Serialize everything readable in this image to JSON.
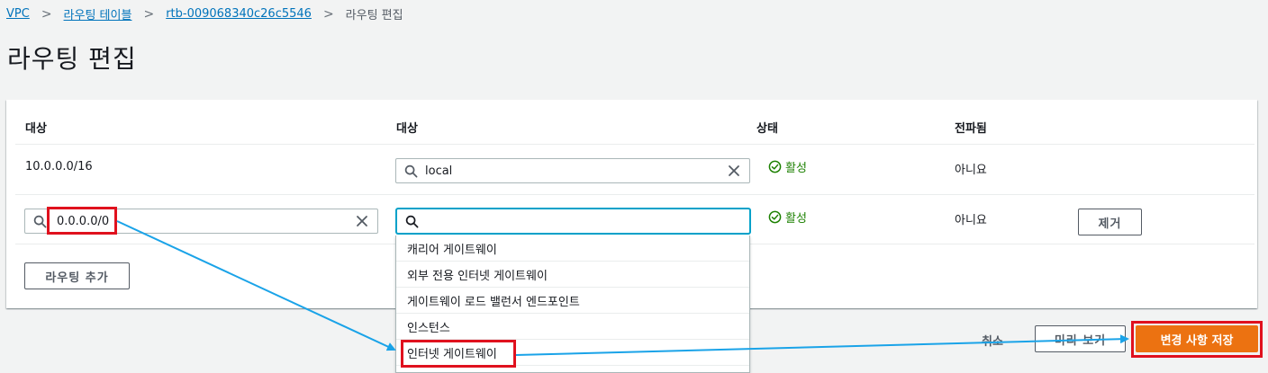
{
  "breadcrumb": {
    "vpc": "VPC",
    "route_tables": "라우팅 테이블",
    "rtb_id": "rtb-009068340c26c5546",
    "current": "라우팅 편집",
    "separator": ">"
  },
  "page_title": "라우팅 편집",
  "table": {
    "headers": [
      "대상",
      "대상",
      "상태",
      "전파됨"
    ],
    "rows": [
      {
        "destination": "10.0.0.0/16",
        "target": "local",
        "status": "활성",
        "propagated": "아니요"
      },
      {
        "destination": "0.0.0.0/0",
        "target": "",
        "status": "활성",
        "propagated": "아니요",
        "remove": "제거"
      }
    ],
    "add_route": "라우팅 추가"
  },
  "dropdown": {
    "options": [
      "캐리어 게이트웨이",
      "외부 전용 인터넷 게이트웨이",
      "게이트웨이 로드 밸런서 엔드포인트",
      "인스턴스",
      "인터넷 게이트웨이"
    ],
    "highlighted_option": "인터넷 게이트웨이"
  },
  "footer": {
    "cancel": "취소",
    "preview": "미리 보기",
    "save": "변경 사항 저장"
  },
  "colors": {
    "link": "#0073bb",
    "status_active": "#1d8102",
    "primary": "#ec7211",
    "annotation_highlight": "#e0111e",
    "annotation_arrow": "#1aa3e8"
  },
  "icons": [
    "chevron-right-icon",
    "search-icon",
    "clear-icon",
    "status-ok-icon",
    "annotation-arrow-icon"
  ]
}
